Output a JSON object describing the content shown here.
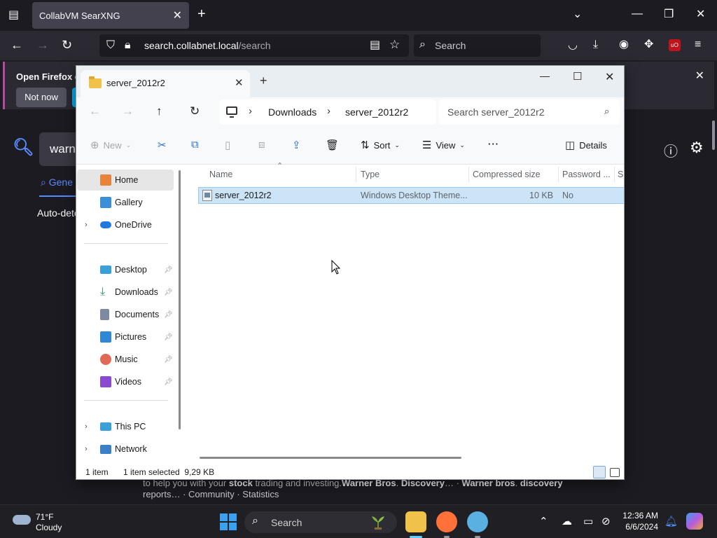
{
  "browser": {
    "tab_title": "CollabVM SearXNG",
    "url_host": "search.collabnet.local",
    "url_path": "/search",
    "search_placeholder": "Search",
    "notice_text": "Open Firefox ev",
    "notice_button": "Not now"
  },
  "page": {
    "query_fragment": "warne",
    "category_fragment": "Gene",
    "language_fragment": "Auto-dete",
    "footer_line1_pre": "to help you with your ",
    "footer_line1_bold1": "stock",
    "footer_line1_mid": " trading and investing.",
    "footer_line1_bold2": "Warner Bros",
    "footer_line1_sep": ". ",
    "footer_line1_bold3": "Discovery",
    "footer_line1_post": "… · ",
    "footer_line1_bold4": "Warner bros",
    "footer_line1_sep2": ". ",
    "footer_line1_bold5": "discovery",
    "footer_line2": "reports… · Community · Statistics"
  },
  "explorer": {
    "tab_title": "server_2012r2",
    "breadcrumb": [
      "Downloads",
      "server_2012r2"
    ],
    "search_placeholder": "Search server_2012r2",
    "commands": {
      "new": "New",
      "sort": "Sort",
      "view": "View",
      "more": "···",
      "details": "Details"
    },
    "sidebar": {
      "quick": [
        {
          "label": "Home",
          "icon": "home-icon",
          "color": "#e8833a"
        },
        {
          "label": "Gallery",
          "icon": "gallery-icon",
          "color": "#3a8fd8"
        },
        {
          "label": "OneDrive",
          "icon": "onedrive-icon",
          "color": "#1f7ae0"
        }
      ],
      "pinned": [
        {
          "label": "Desktop",
          "icon": "desktop-icon",
          "color": "#3aa0d8"
        },
        {
          "label": "Downloads",
          "icon": "downloads-icon",
          "color": "#2a9d6a"
        },
        {
          "label": "Documents",
          "icon": "documents-icon",
          "color": "#7d8aa0"
        },
        {
          "label": "Pictures",
          "icon": "pictures-icon",
          "color": "#2f88d6"
        },
        {
          "label": "Music",
          "icon": "music-icon",
          "color": "#e06a55"
        },
        {
          "label": "Videos",
          "icon": "videos-icon",
          "color": "#8a4bd0"
        }
      ],
      "devices": [
        {
          "label": "This PC",
          "icon": "this-pc-icon",
          "color": "#3aa0d8"
        },
        {
          "label": "Network",
          "icon": "network-icon",
          "color": "#3a7fc8"
        }
      ]
    },
    "columns": [
      "Name",
      "Type",
      "Compressed size",
      "Password ...",
      "Si"
    ],
    "files": [
      {
        "name": "server_2012r2",
        "type": "Windows Desktop Theme...",
        "compressed_size": "10 KB",
        "password": "No"
      }
    ],
    "status": {
      "count": "1 item",
      "selected": "1 item selected  9,29 KB"
    }
  },
  "taskbar": {
    "weather_temp": "71°F",
    "weather_cond": "Cloudy",
    "search_label": "Search",
    "time": "12:36 AM",
    "date": "6/6/2024"
  }
}
